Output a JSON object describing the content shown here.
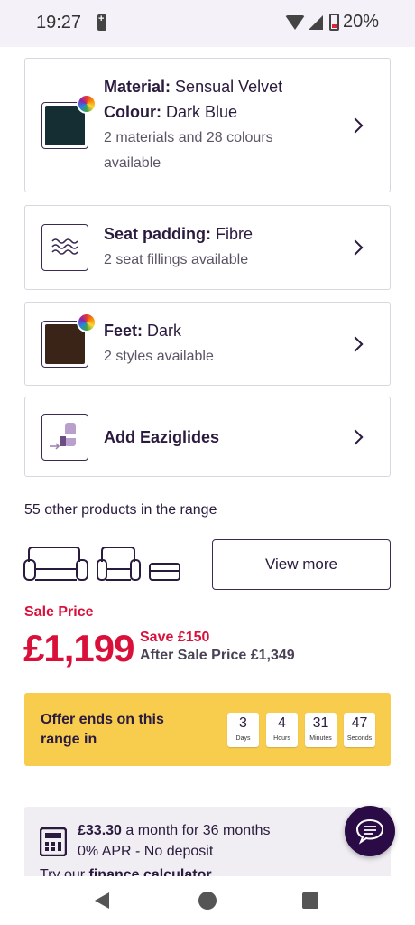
{
  "status_bar": {
    "time": "19:27",
    "battery": "20%"
  },
  "options": [
    {
      "label": "Material:",
      "value": "Sensual Velvet",
      "label2": "Colour:",
      "value2": "Dark Blue",
      "sub": "2 materials and 28 colours available",
      "swatch_color": "#152e33"
    },
    {
      "label": "Seat padding:",
      "value": "Fibre",
      "sub": "2 seat fillings available"
    },
    {
      "label": "Feet:",
      "value": "Dark",
      "sub": "2 styles available",
      "swatch_color": "#3a2418"
    },
    {
      "label": "Add Eaziglides"
    }
  ],
  "range": {
    "text": "55 other products in the range",
    "button": "View more"
  },
  "price": {
    "sale_label": "Sale Price",
    "amount": "£1,199",
    "save": "Save £150",
    "after": "After Sale Price £1,349"
  },
  "offer": {
    "text": "Offer ends on this range in",
    "countdown": [
      {
        "value": "3",
        "unit": "Days"
      },
      {
        "value": "4",
        "unit": "Hours"
      },
      {
        "value": "31",
        "unit": "Minutes"
      },
      {
        "value": "47",
        "unit": "Seconds"
      }
    ]
  },
  "finance": {
    "monthly": "£33.30",
    "monthly_suffix": "a month for 36 months",
    "terms": "0% APR - No deposit",
    "calc_prefix": "Try our",
    "calc_link": "finance calculator"
  },
  "colors": {
    "accent_red": "#d8103a",
    "offer_yellow": "#f8cd4e",
    "brand_purple": "#2b0b45"
  }
}
